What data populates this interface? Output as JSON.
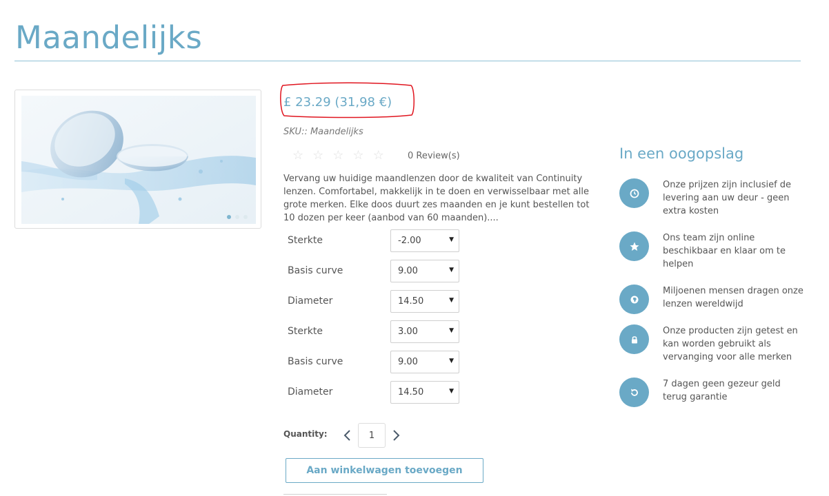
{
  "page": {
    "title": "Maandelijks"
  },
  "product": {
    "price": "£ 23.29 (31,98 €)",
    "sku": "SKU:: Maandelijks",
    "rating": {
      "stars": 0,
      "max": 5,
      "reviews_label": "0 Review(s)"
    },
    "description": "Vervang uw huidige maandlenzen door de kwaliteit van Continuity lenzen. Comfortabel, makkelijk in te doen en verwisselbaar met alle grote merken. Elke doos duurt zes maanden en je kunt bestellen tot 10 dozen per keer (aanbod van 60 maanden)....",
    "image": {
      "icon": "contact-lens-image",
      "slides": 3,
      "active_slide": 1
    },
    "options": [
      {
        "label": "Sterkte",
        "value": "-2.00"
      },
      {
        "label": "Basis curve",
        "value": "9.00"
      },
      {
        "label": "Diameter",
        "value": "14.50"
      },
      {
        "label": "Sterkte",
        "value": "3.00"
      },
      {
        "label": "Basis curve",
        "value": "9.00"
      },
      {
        "label": "Diameter",
        "value": "14.50"
      }
    ],
    "quantity": {
      "label": "Quantity:",
      "value": "1"
    },
    "add_to_cart_label": "Aan winkelwagen toevoegen"
  },
  "glance": {
    "title": "In een oogopslag",
    "features": [
      {
        "icon": "clock-icon",
        "text": "Onze prijzen zijn inclusief de levering aan uw deur - geen extra kosten"
      },
      {
        "icon": "star-icon",
        "text": "Ons team zijn online beschikbaar en klaar om te helpen"
      },
      {
        "icon": "globe-icon",
        "text": "Miljoenen mensen dragen onze lenzen wereldwijd"
      },
      {
        "icon": "lock-icon",
        "text": "Onze producten zijn getest en kan worden gebruikt als vervanging voor alle merken"
      },
      {
        "icon": "refresh-icon",
        "text": "7 dagen geen gezeur geld terug garantie"
      }
    ]
  },
  "colors": {
    "accent": "#6aa9c6",
    "highlight_ring": "#e0141e"
  }
}
